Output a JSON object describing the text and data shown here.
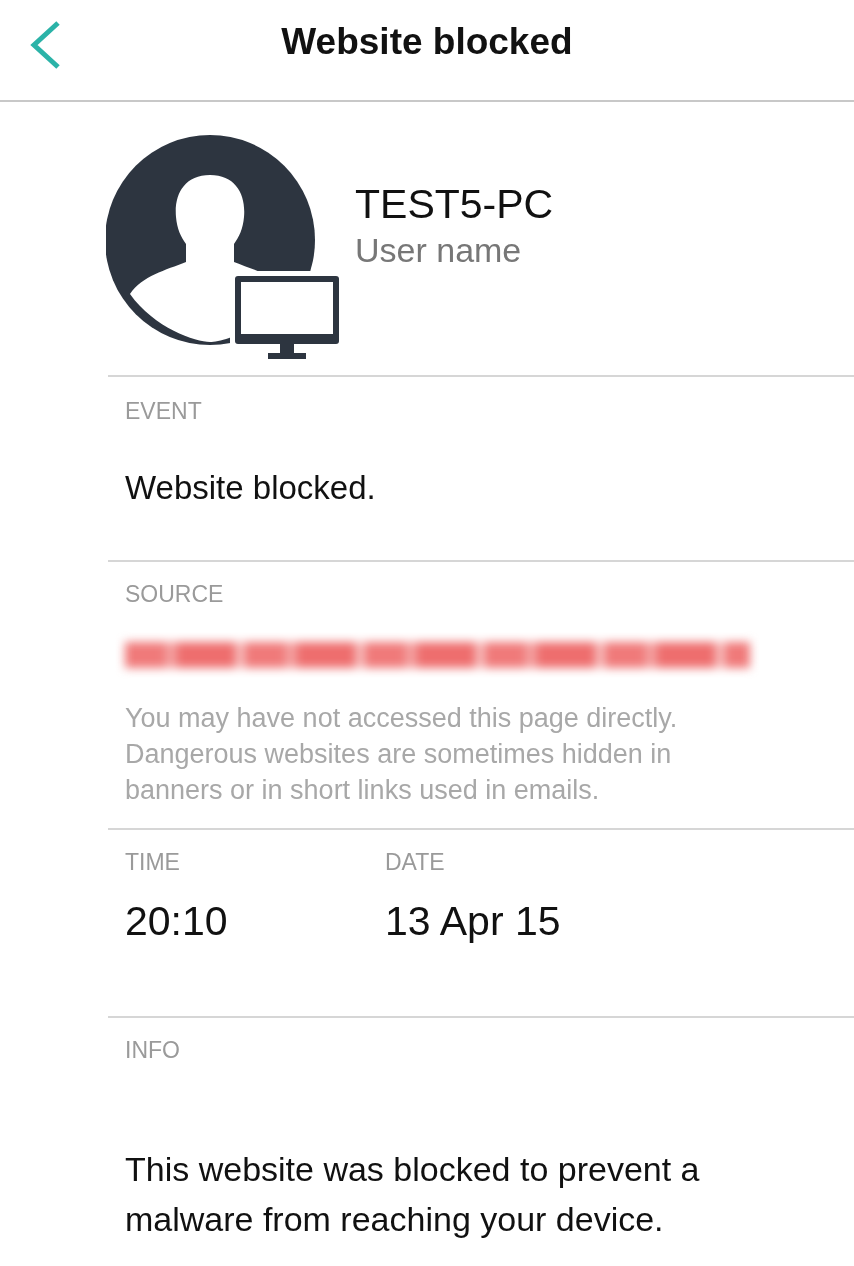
{
  "header": {
    "title": "Website blocked"
  },
  "device": {
    "name": "TEST5-PC",
    "user": "User name"
  },
  "event": {
    "label": "EVENT",
    "value": "Website blocked."
  },
  "source": {
    "label": "SOURCE",
    "note": "You may have not accessed this page directly. Dangerous websites are sometimes hidden in banners or in short links used in emails."
  },
  "time": {
    "label": "TIME",
    "value": "20:10"
  },
  "date": {
    "label": "DATE",
    "value": "13 Apr 15"
  },
  "info": {
    "label": "INFO",
    "text": "This website was blocked to prevent a malware from reaching your device."
  }
}
